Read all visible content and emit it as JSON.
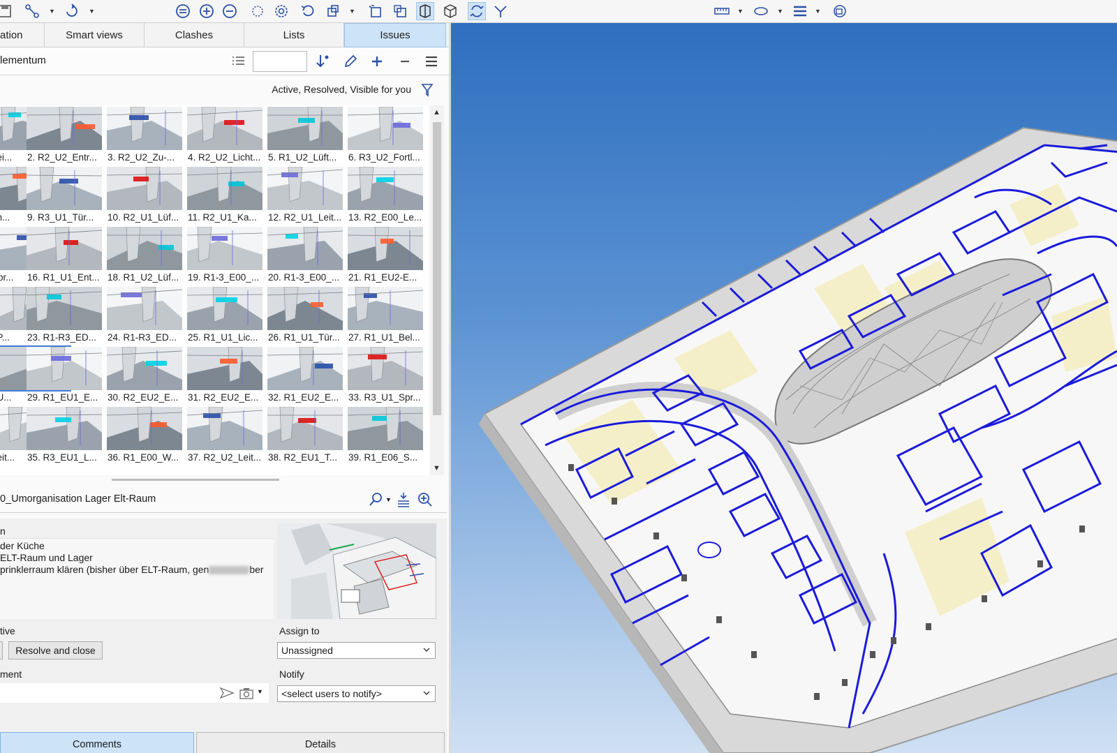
{
  "tabs": [
    {
      "label": "ation"
    },
    {
      "label": "Smart views"
    },
    {
      "label": "Clashes"
    },
    {
      "label": "Lists"
    },
    {
      "label": "Issues"
    }
  ],
  "list": {
    "title": "lementum",
    "search_value": ""
  },
  "filter": {
    "text": "Active, Resolved, Visible for you"
  },
  "issues": [
    {
      "caption": "Lei..."
    },
    {
      "caption": "2. R2_U2_Entr..."
    },
    {
      "caption": "3. R2_U2_Zu-..."
    },
    {
      "caption": "4. R2_U2_Licht..."
    },
    {
      "caption": "5. R1_U2_Lüft..."
    },
    {
      "caption": "6. R3_U2_Fortl..."
    },
    {
      "caption": "an..."
    },
    {
      "caption": "9. R3_U1_Tür..."
    },
    {
      "caption": "10. R2_U1_Lüf..."
    },
    {
      "caption": "11. R2_U1_Ka..."
    },
    {
      "caption": "12. R2_U1_Leit..."
    },
    {
      "caption": "13. R2_E00_Le..."
    },
    {
      "caption": "Spr..."
    },
    {
      "caption": "16. R1_U1_Ent..."
    },
    {
      "caption": "18. R1_U2_Lüf..."
    },
    {
      "caption": "19. R1-3_E00_..."
    },
    {
      "caption": "20. R1-3_E00_..."
    },
    {
      "caption": "21. R1_EU2-E..."
    },
    {
      "caption": "_P..."
    },
    {
      "caption": "23. R1-R3_ED..."
    },
    {
      "caption": "24. R1-R3_ED..."
    },
    {
      "caption": "25. R1_U1_Lic..."
    },
    {
      "caption": "26. R1_U1_Tür..."
    },
    {
      "caption": "27. R1_U1_Bel..."
    },
    {
      "caption": "_U..."
    },
    {
      "caption": "29. R1_EU1_E..."
    },
    {
      "caption": "30. R2_EU2_E..."
    },
    {
      "caption": "31. R2_EU2_E..."
    },
    {
      "caption": "32. R1_EU2_E..."
    },
    {
      "caption": "33. R3_U1_Spr..."
    },
    {
      "caption": "Leit..."
    },
    {
      "caption": "35. R3_EU1_L..."
    },
    {
      "caption": "36. R1_E00_W..."
    },
    {
      "caption": "37. R2_U2_Leit..."
    },
    {
      "caption": "38. R2_EU1_T..."
    },
    {
      "caption": "39. R1_E06_S..."
    }
  ],
  "issue": {
    "title": "0_Umorganisation Lager  Elt-Raum",
    "description_label": "n",
    "description_lines": [
      " der Küche",
      " ELT-Raum und Lager",
      "prinklerraum klären (bisher über ELT-Raum, gen"
    ],
    "description_tail": "ber",
    "status_label": "tive",
    "resolve_label": "Resolve and close",
    "assign_label": "Assign to",
    "assign_value": "Unassigned",
    "comment_label": "ment",
    "comment_value": "",
    "notify_label": "Notify",
    "notify_value": "<select users to notify>"
  },
  "bottom_tabs": [
    {
      "label": "Comments"
    },
    {
      "label": "Details"
    }
  ],
  "colors": {
    "accent": "#cde3f8",
    "model_wall": "#1a1adb",
    "sky_top": "#2f6fbf"
  },
  "icons": {
    "toolbar": [
      "save-icon",
      "path-icon",
      "orbit-icon",
      "zoom-fit-icon",
      "zoom-in-icon",
      "zoom-out-icon",
      "section-icon",
      "settings-icon",
      "undo-icon",
      "cube-icon",
      "box-select-icon",
      "box-select-2-icon",
      "perspective-icon",
      "iso-cube-icon",
      "rotate-icon",
      "walk-icon",
      "measure-icon",
      "ellipse-icon",
      "layers-icon",
      "hide-icon"
    ]
  }
}
